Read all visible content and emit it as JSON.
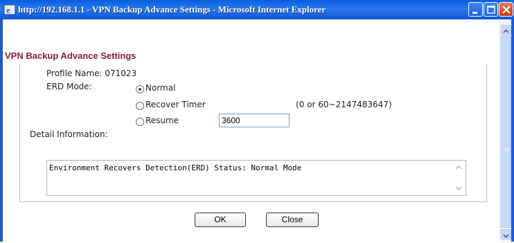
{
  "window": {
    "title": "http://192.168.1.1 - VPN Backup Advance Settings - Microsoft Internet Explorer"
  },
  "page": {
    "heading": "VPN Backup Advance Settings",
    "profile_label": "Profile Name: 071023",
    "erd_mode_label": "ERD Mode:",
    "options": [
      {
        "label": "Normal",
        "checked": true
      },
      {
        "label": "Recover Timer",
        "checked": false
      },
      {
        "label": "Resume",
        "checked": false
      }
    ],
    "timer_value": "3600",
    "timer_range": "(0 or 60~2147483647)",
    "detail_label": "Detail Information:",
    "detail_text": "Environment Recovers Detection(ERD) Status: Normal Mode"
  },
  "buttons": {
    "ok": "OK",
    "close": "Close"
  },
  "colors": {
    "heading": "#8b1a3c",
    "titlebar": "#0a5fe0"
  }
}
